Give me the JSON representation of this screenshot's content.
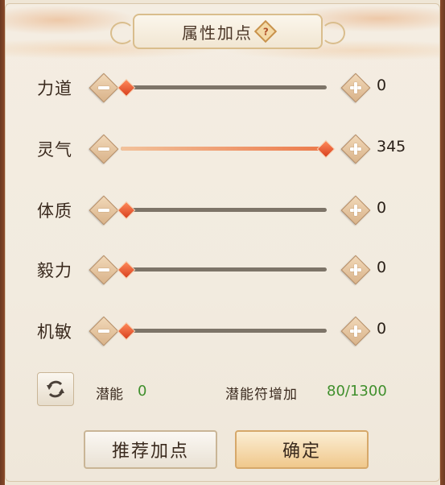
{
  "header": {
    "title": "属性加点",
    "help_glyph": "?"
  },
  "attributes": [
    {
      "label": "力道",
      "value": "0",
      "level": 0.0
    },
    {
      "label": "灵气",
      "value": "345",
      "level": 1.0
    },
    {
      "label": "体质",
      "value": "0",
      "level": 0.0
    },
    {
      "label": "毅力",
      "value": "0",
      "level": 0.0
    },
    {
      "label": "机敏",
      "value": "0",
      "level": 0.0
    }
  ],
  "footer": {
    "potential_label": "潜能",
    "potential_value": "0",
    "rune_label": "潜能符增加",
    "rune_value": "80/1300"
  },
  "buttons": {
    "recommend": "推荐加点",
    "confirm": "确定"
  },
  "icons": {
    "reset": "refresh-icon",
    "minus": "minus-icon",
    "plus": "plus-icon",
    "help": "help-icon"
  },
  "colors": {
    "value_green": "#3f8f2c",
    "knob": "#e05a2c",
    "fill": "#ec7a4a"
  }
}
